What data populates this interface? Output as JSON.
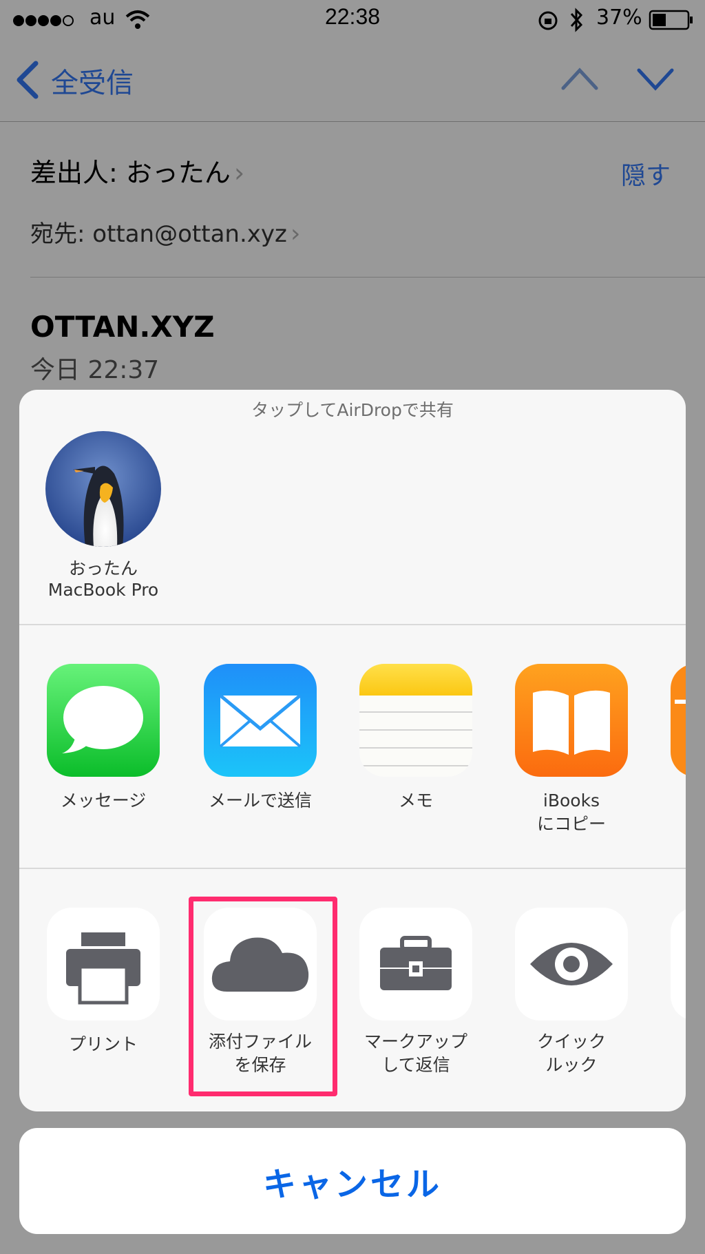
{
  "status_bar": {
    "carrier": "au",
    "time": "22:38",
    "battery": "37%"
  },
  "mail_nav": {
    "back_label": "全受信"
  },
  "mail_header": {
    "from_label": "差出人: おったん",
    "hide_label": "隠す",
    "to_label": "宛先: ottan@ottan.xyz",
    "subject": "OTTAN.XYZ",
    "date": "今日 22:37"
  },
  "share_sheet": {
    "airdrop_title": "タップしてAirDropで共有",
    "airdrop_device": {
      "name": "おったん",
      "model": "MacBook Pro"
    },
    "apps": [
      {
        "label": "メッセージ",
        "icon": "messages-icon"
      },
      {
        "label": "メールで送信",
        "icon": "mail-icon"
      },
      {
        "label": "メモ",
        "icon": "notes-icon"
      },
      {
        "label_line1": "iBooks",
        "label_line2": "にコピー",
        "icon": "ibooks-icon"
      }
    ],
    "actions": [
      {
        "label": "プリント",
        "icon": "printer-icon"
      },
      {
        "label_line1": "添付ファイル",
        "label_line2": "を保存",
        "icon": "cloud-icon"
      },
      {
        "label_line1": "マークアップ",
        "label_line2": "して返信",
        "icon": "toolbox-icon"
      },
      {
        "label_line1": "クイック",
        "label_line2": "ルック",
        "icon": "eye-icon"
      }
    ],
    "cancel_label": "キャンセル"
  },
  "colors": {
    "accent": "#0a66e6",
    "highlight": "#ff2c6f",
    "icon_gray": "#5f6066"
  }
}
